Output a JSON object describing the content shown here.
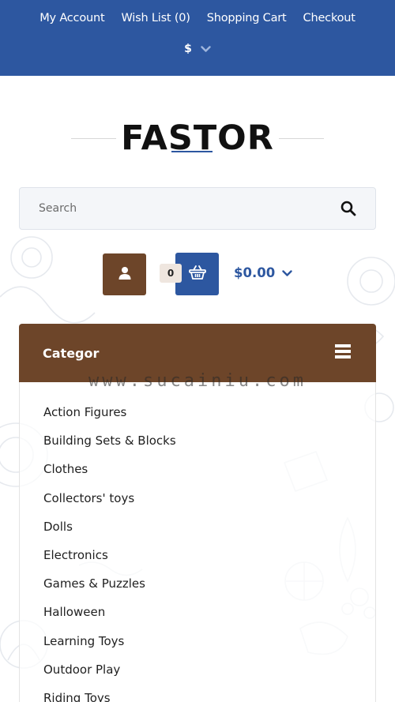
{
  "topbar": {
    "links": [
      "My Account",
      "Wish List (0)",
      "Shopping Cart",
      "Checkout"
    ],
    "currency_symbol": "$",
    "background": "#2d57a0"
  },
  "logo": {
    "text_part1": "FAS",
    "text_part2": "T",
    "text_part3": "OR"
  },
  "search": {
    "placeholder": "Search",
    "icon": "search-icon"
  },
  "header_actions": {
    "account_icon": "user-icon",
    "cart_count": "0",
    "cart_icon": "basket-icon",
    "cart_total": "$0.00"
  },
  "categories": {
    "title": "Categor",
    "menu_icon": "hamburger-icon",
    "items": [
      "Action Figures",
      "Building Sets & Blocks",
      "Clothes",
      "Collectors' toys",
      "Dolls",
      "Electronics",
      "Games & Puzzles",
      "Halloween",
      "Learning Toys",
      "Outdoor Play",
      "Riding Toys"
    ]
  },
  "watermark": "www.sucainiu.com",
  "colors": {
    "primary_blue": "#2d57a0",
    "brown": "#6d4529",
    "text": "#1f1f1f"
  }
}
